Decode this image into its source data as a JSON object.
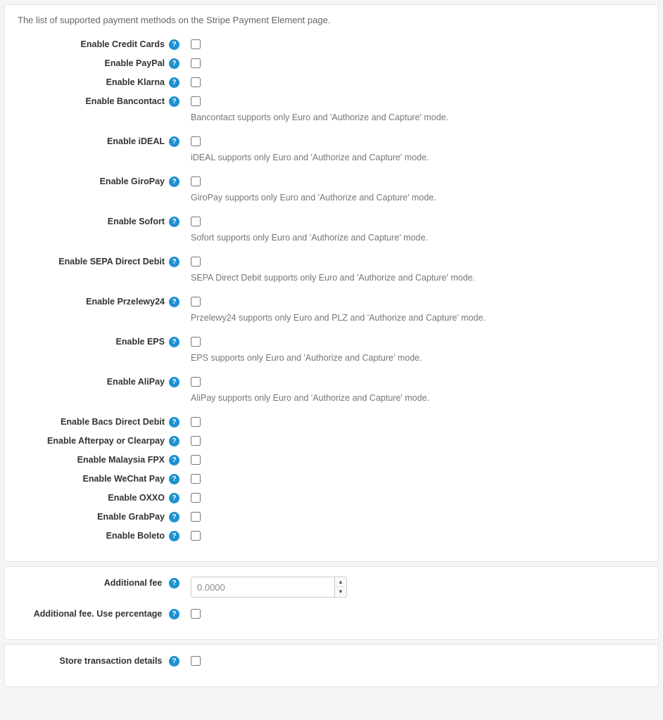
{
  "intro": "The list of supported payment methods on the Stripe Payment Element page.",
  "helpGlyph": "?",
  "options": [
    {
      "key": "credit",
      "label": "Enable Credit Cards",
      "hint": null
    },
    {
      "key": "paypal",
      "label": "Enable PayPal",
      "hint": null
    },
    {
      "key": "klarna",
      "label": "Enable Klarna",
      "hint": null
    },
    {
      "key": "bancontact",
      "label": "Enable Bancontact",
      "hint": "Bancontact supports only Euro and 'Authorize and Capture' mode."
    },
    {
      "key": "ideal",
      "label": "Enable iDEAL",
      "hint": "iDEAL supports only Euro and 'Authorize and Capture' mode."
    },
    {
      "key": "giropay",
      "label": "Enable GiroPay",
      "hint": "GiroPay supports only Euro and 'Authorize and Capture' mode."
    },
    {
      "key": "sofort",
      "label": "Enable Sofort",
      "hint": "Sofort supports only Euro and 'Authorize and Capture' mode."
    },
    {
      "key": "sepa",
      "label": "Enable SEPA Direct Debit",
      "hint": "SEPA Direct Debit supports only Euro and 'Authorize and Capture' mode."
    },
    {
      "key": "p24",
      "label": "Enable Przelewy24",
      "hint": "Przelewy24 supports only Euro and PLZ and 'Authorize and Capture' mode."
    },
    {
      "key": "eps",
      "label": "Enable EPS",
      "hint": "EPS supports only Euro and 'Authorize and Capture' mode."
    },
    {
      "key": "alipay",
      "label": "Enable AliPay",
      "hint": "AliPay supports only Euro and 'Authorize and Capture' mode."
    },
    {
      "key": "bacs",
      "label": "Enable Bacs Direct Debit",
      "hint": null
    },
    {
      "key": "afterpay",
      "label": "Enable Afterpay or Clearpay",
      "hint": null
    },
    {
      "key": "fpx",
      "label": "Enable Malaysia FPX",
      "hint": null
    },
    {
      "key": "wechat",
      "label": "Enable WeChat Pay",
      "hint": null
    },
    {
      "key": "oxxo",
      "label": "Enable OXXO",
      "hint": null
    },
    {
      "key": "grabpay",
      "label": "Enable GrabPay",
      "hint": null
    },
    {
      "key": "boleto",
      "label": "Enable Boleto",
      "hint": null
    }
  ],
  "fees": {
    "additionalFeeLabel": "Additional fee",
    "additionalFeeValue": "0.0000",
    "usePercentageLabel": "Additional fee. Use percentage"
  },
  "store": {
    "label": "Store transaction details"
  }
}
